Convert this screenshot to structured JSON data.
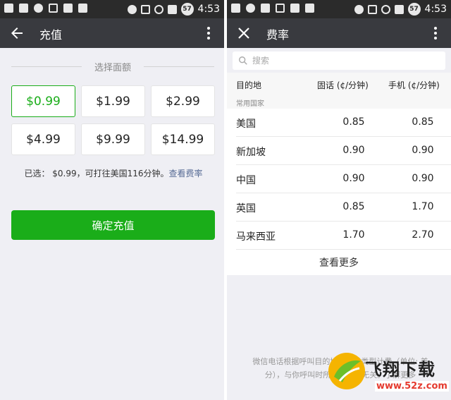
{
  "status_bar": {
    "time": "4:53",
    "battery": "57"
  },
  "recharge_screen": {
    "title": "充值",
    "section_label": "选择面额",
    "amounts": [
      "$0.99",
      "$1.99",
      "$2.99",
      "$4.99",
      "$9.99",
      "$14.99"
    ],
    "selected_amount": "$0.99",
    "selected_info": "已选： $0.99，可打往美国116分钟。",
    "view_rates_link": "查看费率",
    "confirm_button": "确定充值"
  },
  "rates_screen": {
    "title": "费率",
    "search_placeholder": "搜索",
    "headers": {
      "destination": "目的地",
      "landline": "固话 (¢/分钟)",
      "mobile": "手机 (¢/分钟)"
    },
    "group_label": "常用国家",
    "rows": [
      {
        "destination": "美国",
        "landline": "0.85",
        "mobile": "0.85"
      },
      {
        "destination": "新加坡",
        "landline": "0.90",
        "mobile": "0.90"
      },
      {
        "destination": "中国",
        "landline": "0.90",
        "mobile": "0.90"
      },
      {
        "destination": "英国",
        "landline": "0.85",
        "mobile": "1.70"
      },
      {
        "destination": "马来西亚",
        "landline": "1.70",
        "mobile": "2.70"
      }
    ],
    "see_more": "查看更多",
    "footnote_line1": "微信电话根据呼叫目的地和号码类型计费（单位: 美",
    "footnote_line2": "分），与你呼叫时所在的地方无关。了解更多"
  },
  "watermark": {
    "title": "飞翔下载",
    "url": "www.52z.com"
  },
  "colors": {
    "accent": "#1aad19",
    "toolbar": "#393a3f",
    "link": "#576b95"
  }
}
